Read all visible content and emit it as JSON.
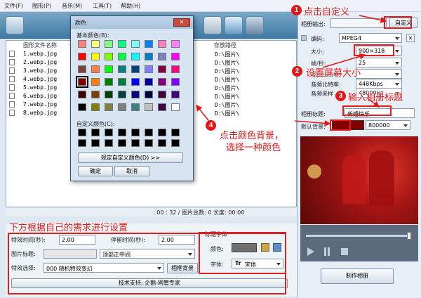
{
  "menu": [
    "文件(F)",
    "图形(P)",
    "音乐(M)",
    "工具(T)",
    "帮助(H)"
  ],
  "file_list": {
    "col_name": "图形文件名称",
    "col_path": "存放路径",
    "rows": [
      {
        "name": "1.webp.jpg",
        "path": "D:\\图片\\"
      },
      {
        "name": "2.webp.jpg",
        "path": "D:\\图片\\"
      },
      {
        "name": "3.webp.jpg",
        "path": "D:\\图片\\"
      },
      {
        "name": "4.webp.jpg",
        "path": "D:\\图片\\"
      },
      {
        "name": "5.webp.jpg",
        "path": "D:\\图片\\"
      },
      {
        "name": "6.webp.jpg",
        "path": "D:\\图片\\"
      },
      {
        "name": "7.webp.jpg",
        "path": "D:\\图片\\"
      },
      {
        "name": "8.webp.jpg",
        "path": "D:\\图片\\"
      }
    ]
  },
  "status": {
    "text": ": 00 : 32 / 图片总数: 0 长度: 00:00"
  },
  "bottom": {
    "effect_time_label": "特效时间(秒):",
    "effect_time": "2.00",
    "pause_time_label": "停留时间(秒):",
    "pause_time": "2.00",
    "pic_title_label": "图片标题:",
    "pic_title_pos": "顶部正中间",
    "effect_select_label": "特效选择:",
    "effect_select": "000 随机特效变幻",
    "related_bg_button": "相框背景",
    "title_font_group": "标题字体",
    "color_label": "颜色:",
    "font_label": "字体:",
    "font_value": "宋体",
    "tech_support": "技术支持: 企鹅-网管专家"
  },
  "right": {
    "output_label": "相册输出:",
    "custom_button": "自定义",
    "encode_label": "编码:",
    "encode_value": "MPEG4",
    "size_label": "大小:",
    "size_value": "900×318",
    "fps_label": "帧/秒:",
    "fps_value": "25",
    "bitrate_label": "视频比特率:",
    "bitrate_value": "",
    "audio_bitrate_label": "音频比特率:",
    "audio_bitrate_value": "448Kbps",
    "audio_sample_label": "音频采样",
    "audio_sample_value": "48000Hz",
    "album_title_label": "相册标题:",
    "album_title_value": "新婚快乐",
    "default_bg_label": "默认背景:",
    "default_bg_value": "800000",
    "make_button": "制作相册"
  },
  "dialog": {
    "title": "颜色",
    "basic_label": "基本颜色(B):",
    "custom_label": "自定义颜色(C):",
    "define_button": "规定自定义颜色(D) >>",
    "ok_button": "确定",
    "cancel_button": "取消",
    "close_glyph": "✕",
    "basic_colors": [
      "#ff8080",
      "#ffff80",
      "#80ff80",
      "#00ff80",
      "#80ffff",
      "#0080ff",
      "#ff80c0",
      "#ff80ff",
      "#ff0000",
      "#ffff00",
      "#80ff00",
      "#00ff40",
      "#00ffff",
      "#0080c0",
      "#8080c0",
      "#ff00ff",
      "#804040",
      "#ff8040",
      "#00ff00",
      "#008080",
      "#004080",
      "#8080ff",
      "#800040",
      "#ff0080",
      "#800000",
      "#ff8000",
      "#008000",
      "#008040",
      "#0000ff",
      "#0000a0",
      "#800080",
      "#8000ff",
      "#400000",
      "#804000",
      "#004000",
      "#004040",
      "#000080",
      "#000040",
      "#400040",
      "#400080",
      "#000000",
      "#808000",
      "#808040",
      "#808080",
      "#408080",
      "#c0c0c0",
      "#400040",
      "#ffffff"
    ],
    "selected_index": 24
  },
  "annotations": [
    {
      "n": "1",
      "text": "点击自定义"
    },
    {
      "n": "2",
      "text": "设置屏幕大小"
    },
    {
      "n": "3",
      "text": "输入相册标题"
    },
    {
      "n": "4",
      "text": "点击颜色背景，"
    },
    {
      "n": "",
      "text": "选择一种颜色"
    },
    {
      "n": "",
      "text": "下方根据自己的需求进行设置"
    }
  ],
  "colors": {
    "annotation_red": "#e01818",
    "default_bg": "#800000"
  }
}
